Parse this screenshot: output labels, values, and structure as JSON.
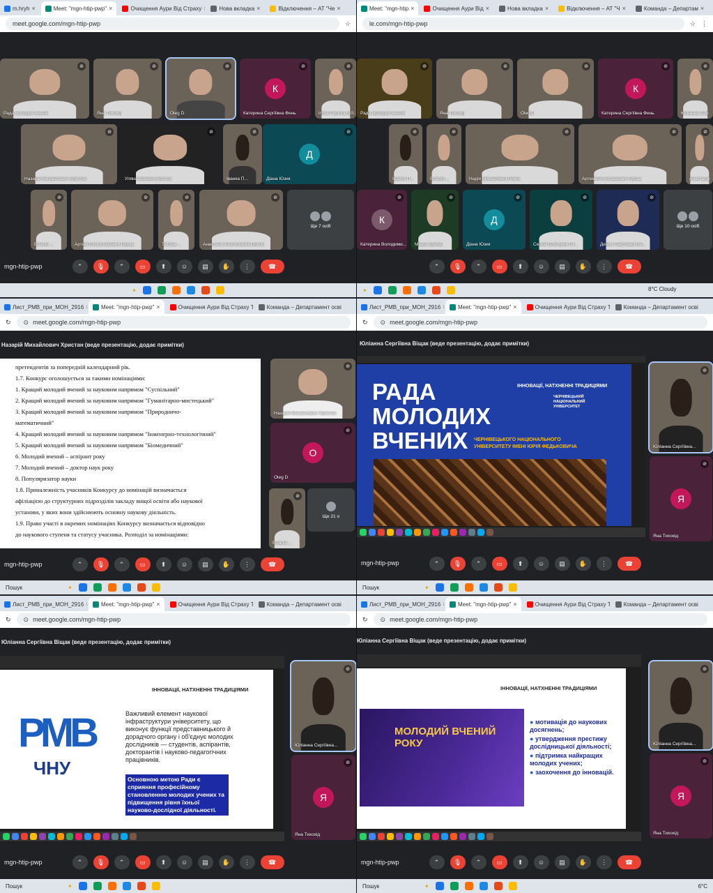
{
  "tl": {
    "tabs": [
      {
        "label": "m.hryh",
        "color": "#1a73e8"
      },
      {
        "label": "Meet: \"mgn-htip-pwp\"",
        "color": "#00897b",
        "active": true
      },
      {
        "label": "Очищення Аури Від Страху",
        "color": "#ff0000"
      },
      {
        "label": "Нова вкладка",
        "color": "#5f6368"
      },
      {
        "label": "Відключення – АТ \"Че",
        "color": "#fbbc04"
      }
    ],
    "url": "meet.google.com/mgn-htip-pwp",
    "tiles": [
      {
        "name": "Рада молодих вчених"
      },
      {
        "name": "Яна Тихохід"
      },
      {
        "name": "Oleg D"
      },
      {
        "name": "Катерина Сергіївна Фень",
        "letter": "К"
      },
      {
        "name": "Iryna Popova (BS"
      },
      {
        "name": "Назарій Михайлович Христан"
      },
      {
        "name": "Уляна Іванівна Костюк"
      },
      {
        "name": "Іванка П..."
      },
      {
        "name": "Діана Юзик",
        "letter": "Д"
      },
      {
        "name": "Віталія ..."
      },
      {
        "name": "Артем В'ячеславович Гурськ"
      },
      {
        "name": "Тетяна ..."
      },
      {
        "name": "Анастасія Анатоліївна Гринзо"
      }
    ],
    "more": "Ще 7 осіб",
    "code": "mgn-htip-pwp"
  },
  "tr": {
    "tabs": [
      {
        "label": "Meet: \"mgn-htip",
        "color": "#00897b",
        "active": true
      },
      {
        "label": "Очищення Аури Від",
        "color": "#ff0000"
      },
      {
        "label": "Нова вкладка",
        "color": "#5f6368"
      },
      {
        "label": "Відключення – АТ \"Ч",
        "color": "#fbbc04"
      },
      {
        "label": "Команда – Департам",
        "color": "#5f6368"
      }
    ],
    "url": "le.com/mgn-htip-pwp",
    "tiles": [
      {
        "name": "Рада молодих вчених"
      },
      {
        "name": "Яна Тихохід"
      },
      {
        "name": "Oleg D"
      },
      {
        "name": "Катерина Сергіївна Фень",
        "letter": "К"
      },
      {
        "name": "Юліанна Сер"
      },
      {
        "name": "Іванка П..."
      },
      {
        "name": "Віталія ..."
      },
      {
        "name": "Надія Михайлівна Ровка"
      },
      {
        "name": "Артем В'ячеславович Гурськ"
      },
      {
        "name": "Анастасія"
      },
      {
        "name": "Катерина Володими...",
        "letter": "К"
      },
      {
        "name": "Маша Кречун"
      },
      {
        "name": "Діана Юзик",
        "letter": "Д"
      },
      {
        "name": "Сергій Олегович Ст..."
      },
      {
        "name": "Денис Павлович Он..."
      }
    ],
    "more": "Ще 10 осіб",
    "weather": "8°C  Cloudy"
  },
  "ml": {
    "tabs": [
      {
        "label": "Лист_РМВ_при_МОН_2916",
        "color": "#1a73e8"
      },
      {
        "label": "Meet: \"mgn-htip-pwp\"",
        "color": "#00897b",
        "active": true
      },
      {
        "label": "Очищення Аури Від Страху Та",
        "color": "#ff0000"
      },
      {
        "label": "Команда – Департамент осві",
        "color": "#5f6368"
      }
    ],
    "url": "meet.google.com/mgn-htip-pwp",
    "presenter": "Назарій Михайлович Христан (веде презентацію, додає примітки)",
    "doc_lines": [
      "претендентів за попередній календарний рік.",
      "1.7. Конкурс оголошується за такими номінаціями:",
      "1. Кращий молодий вчений за науковим напрямом \"Суспільний\"",
      "2. Кращий молодий вчений за науковим напрямом \"Гуманітарно-мистецький\"",
      "3. Кращий молодий вчений за науковим напрямом \"Природничо-",
      "математичний\"",
      "4. Кращий молодий вчений за науковим напрямом \"Інженерно-технологічний\"",
      "5. Кращий молодий вчений за науковим напрямом \"Біомедичний\"",
      "6. Молодий вчений – аспірант року",
      "7. Молодий вчений – доктор наук року",
      "8. Популяризатор науки",
      "1.8. Приналежність учасників Конкурсу до номінацій визначається",
      "афіліацією до структурних підрозділів закладу вищої освіти або наукової",
      "установи, у яких вони здійснюють основну наукову діяльність.",
      "1.9. Право участі в окремих номінаціях Конкурсу визначається відповідно",
      "до наукового ступеня та статусу учасника. Розподіл за номінаціями:"
    ],
    "side": [
      {
        "name": "Назарій Михайлович Христан"
      },
      {
        "name": "Oleg D",
        "letter": "О"
      },
      {
        "name": "Віталія ..."
      }
    ],
    "more": "Ще 21 о",
    "code": "mgn-htip-pwp",
    "search": "Пошук"
  },
  "mr": {
    "tabs": [
      {
        "label": "Лист_РМВ_при_МОН_2916",
        "color": "#1a73e8"
      },
      {
        "label": "Meet: \"mgn-htip-pwp\"",
        "color": "#00897b",
        "active": true
      },
      {
        "label": "Очищення Аури Від Страху Та",
        "color": "#ff0000"
      },
      {
        "label": "Команда – Департамент осві",
        "color": "#5f6368"
      }
    ],
    "url": "meet.google.com/mgn-htip-pwp",
    "presenter": "Юліанна Сергіївна Віщак (веде презентацію, додає примітки)",
    "slide_title": "РАДА МОЛОДИХ ВЧЕНИХ",
    "slide_tagline": "ІННОВАЦІЇ, НАТХНЕННІ ТРАДИЦІЯМИ",
    "slide_univ": "ЧЕРНІВЕЦЬКОГО НАЦІОНАЛЬНОГО УНІВЕРСИТЕТУ ІМЕНІ ЮРІЯ ФЕДЬКОВИЧА",
    "logo_text": "ЧЕРНІВЕЦЬКИЙ НАЦІОНАЛЬНИЙ УНІВЕРСИТЕТ",
    "logo_mark": "ЧНУ",
    "side": [
      {
        "name": "Юліанна Сергіївна..."
      },
      {
        "name": "Яна Тихохід",
        "letter": "Я"
      }
    ],
    "code": "mgn-htip-pwp",
    "search": "Пошук"
  },
  "bl": {
    "tabs": [
      {
        "label": "Лист_РМВ_при_МОН_2916",
        "color": "#1a73e8"
      },
      {
        "label": "Meet: \"mgn-htip-pwp\"",
        "color": "#00897b",
        "active": true
      },
      {
        "label": "Очищення Аури Від Страху Та",
        "color": "#ff0000"
      },
      {
        "label": "Команда – Департамент осві",
        "color": "#5f6368"
      }
    ],
    "url": "meet.google.com/mgn-htip-pwp",
    "presenter": "Юліанна Сергіївна Віщак (веде презентацію, додає примітки)",
    "slide_header": "ІННОВАЦІЇ, НАТХНЕННІ ТРАДИЦІЯМИ",
    "slide_text": "Важливий елемент наукової інфраструктури університету, що виконує функції представницького й дорадчого органу і об'єднує молодих дослідників — студентів, аспірантів, докторантів і науково-педагогічних працівників.",
    "slide_highlight": "Основною метою Ради є сприяння професійному становленню молодих учених та підвищення рівня їхньої науково-дослідної діяльності.",
    "logo_letters": "РМВ",
    "logo_sub": "ЧНУ",
    "side": [
      {
        "name": "Юліанна Сергіївна..."
      },
      {
        "name": "Яна Тихохід",
        "letter": "Я"
      }
    ],
    "code": "mgn-htip-pwp",
    "search": "Пошук"
  },
  "br": {
    "tabs": [
      {
        "label": "Лист_РМВ_при_МОН_2916",
        "color": "#1a73e8"
      },
      {
        "label": "Meet: \"mgn-htip-pwp\"",
        "color": "#00897b",
        "active": true
      },
      {
        "label": "Очищення Аури Від Страху Та",
        "color": "#ff0000"
      },
      {
        "label": "Команда – Департамент осві",
        "color": "#5f6368"
      }
    ],
    "url": "meet.google.com/mgn-htip-pwp",
    "presenter": "Юліанна Сергіївна Віщак (веде презентацію, додає примітки)",
    "slide_header": "ІННОВАЦІЇ, НАТХНЕННІ ТРАДИЦІЯМИ",
    "poster_title": "МОЛОДИЙ ВЧЕНИЙ РОКУ",
    "bullets": [
      "мотивація до наукових досягнень;",
      "утвердження престижу дослідницької діяльності;",
      "підтримка найкращих молодих учених;",
      "заохочення до інновацій."
    ],
    "side": [
      {
        "name": "Юліанна Сергіївна..."
      },
      {
        "name": "Яна Тихохід",
        "letter": "Я"
      }
    ],
    "code": "mgn-htip-pwp",
    "search": "Пошук",
    "weather": "6°C"
  },
  "colors": {
    "red": "#ea4335",
    "accent": "#a8c7fa",
    "navy": "#1d2aa6",
    "slide_blue": "#203fa6"
  }
}
